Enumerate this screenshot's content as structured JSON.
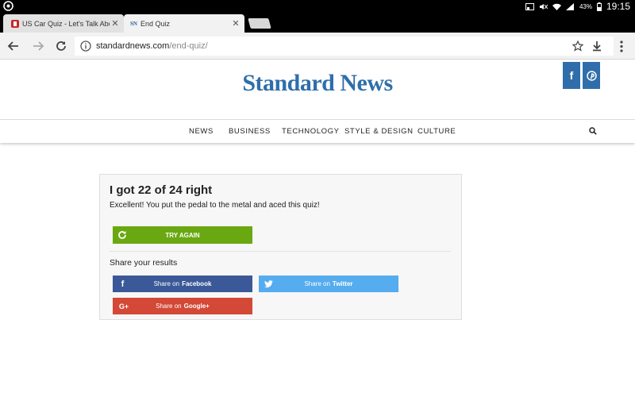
{
  "statusbar": {
    "battery": "43%",
    "time": "19:15"
  },
  "tabs": [
    {
      "label": "US Car Quiz - Let's Talk Abo",
      "close": "✕"
    },
    {
      "label": "End Quiz",
      "favicon_text": "SN",
      "close": "✕"
    }
  ],
  "address_bar": {
    "host": "standardnews.com",
    "path": "/end-quiz/"
  },
  "site": {
    "logo": "Standard News",
    "social": {
      "facebook": "f",
      "pinterest": "℗"
    },
    "nav": [
      "NEWS",
      "BUSINESS",
      "TECHNOLOGY",
      "STYLE & DESIGN",
      "CULTURE"
    ]
  },
  "result": {
    "title": "I got 22 of 24 right",
    "subtitle": "Excellent! You put the pedal to the metal and aced this quiz!",
    "try_again": "TRY AGAIN",
    "share_heading": "Share your results",
    "share_facebook": {
      "prefix": "Share on",
      "network": "Facebook"
    },
    "share_twitter": {
      "prefix": "Share on",
      "network": "Twitter"
    },
    "share_google": {
      "prefix": "Share on",
      "network": "Google+"
    }
  },
  "colors": {
    "brand": "#2f6eaa",
    "try_again": "#6aa812",
    "facebook": "#3b5998",
    "twitter": "#55acee",
    "google": "#d34836"
  },
  "icons": {
    "back": "arrow-back-icon",
    "forward": "arrow-forward-icon",
    "reload": "reload-icon",
    "info": "info-icon",
    "star": "star-icon",
    "download": "download-icon",
    "menu": "more-vert-icon",
    "search": "search-icon"
  }
}
